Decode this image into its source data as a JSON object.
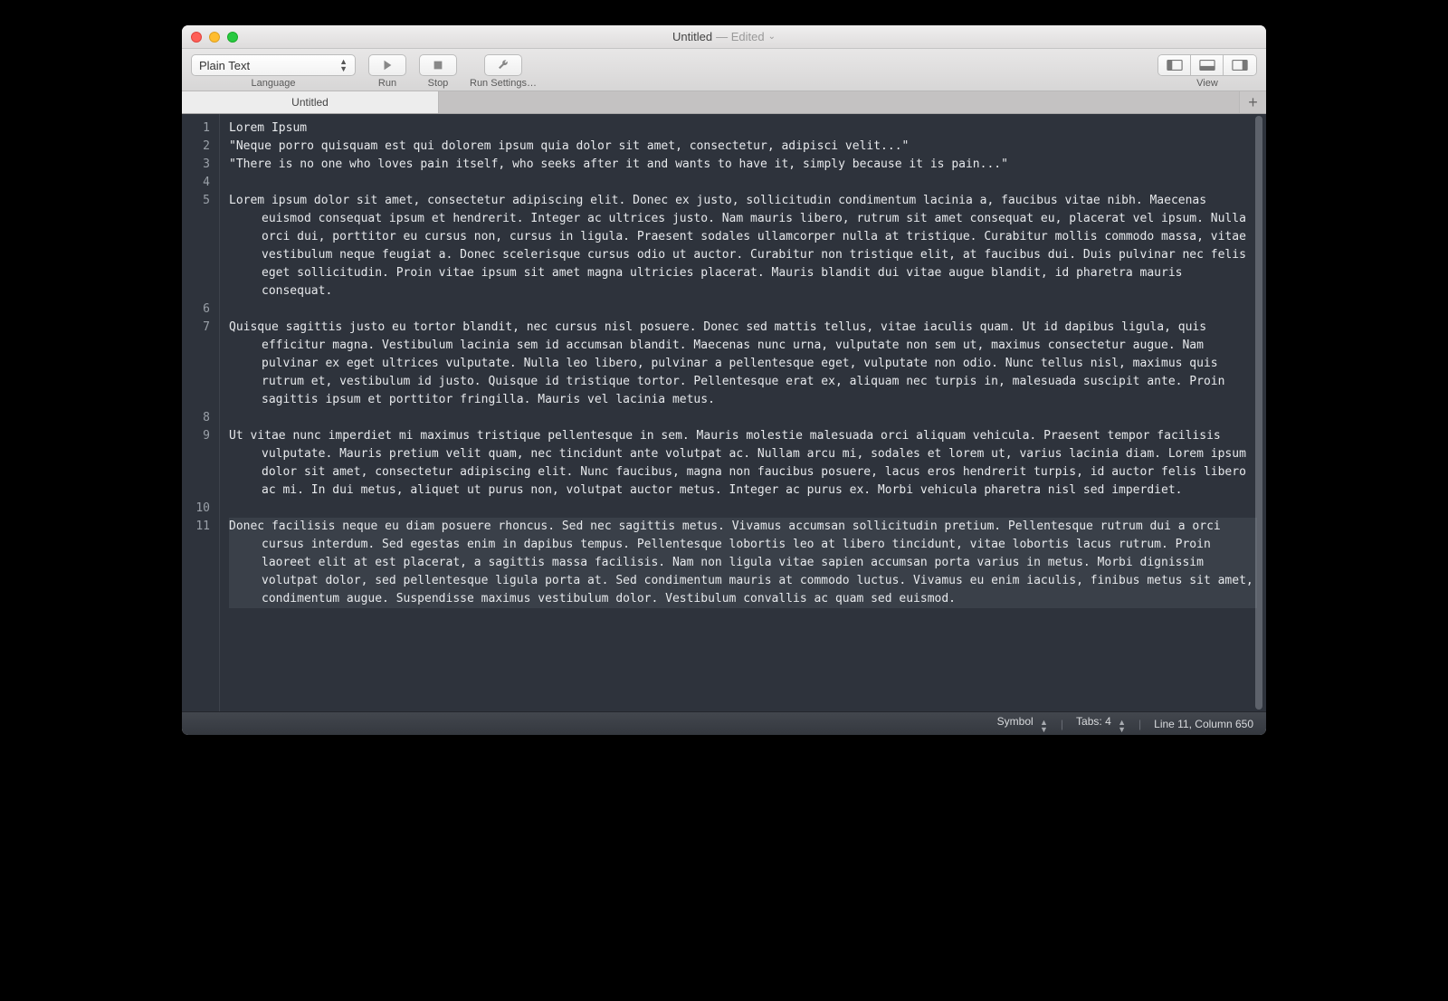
{
  "window": {
    "title": "Untitled",
    "edited_label": "— Edited"
  },
  "toolbar": {
    "language": {
      "value": "Plain Text",
      "label": "Language"
    },
    "run_label": "Run",
    "stop_label": "Stop",
    "settings_label": "Run Settings…",
    "view_label": "View"
  },
  "tabs": {
    "active": "Untitled"
  },
  "document": {
    "lines": [
      {
        "n": 1,
        "text": "Lorem Ipsum"
      },
      {
        "n": 2,
        "text": "\"Neque porro quisquam est qui dolorem ipsum quia dolor sit amet, consectetur, adipisci velit...\""
      },
      {
        "n": 3,
        "text": "\"There is no one who loves pain itself, who seeks after it and wants to have it, simply because it is pain...\""
      },
      {
        "n": 4,
        "text": ""
      },
      {
        "n": 5,
        "text": "Lorem ipsum dolor sit amet, consectetur adipiscing elit. Donec ex justo, sollicitudin condimentum lacinia a, faucibus vitae nibh. Maecenas euismod consequat ipsum et hendrerit. Integer ac ultrices justo. Nam mauris libero, rutrum sit amet consequat eu, placerat vel ipsum. Nulla orci dui, porttitor eu cursus non, cursus in ligula. Praesent sodales ullamcorper nulla at tristique. Curabitur mollis commodo massa, vitae vestibulum neque feugiat a. Donec scelerisque cursus odio ut auctor. Curabitur non tristique elit, at faucibus dui. Duis pulvinar nec felis eget sollicitudin. Proin vitae ipsum sit amet magna ultricies placerat. Mauris blandit dui vitae augue blandit, id pharetra mauris consequat."
      },
      {
        "n": 6,
        "text": ""
      },
      {
        "n": 7,
        "text": "Quisque sagittis justo eu tortor blandit, nec cursus nisl posuere. Donec sed mattis tellus, vitae iaculis quam. Ut id dapibus ligula, quis efficitur magna. Vestibulum lacinia sem id accumsan blandit. Maecenas nunc urna, vulputate non sem ut, maximus consectetur augue. Nam pulvinar ex eget ultrices vulputate. Nulla leo libero, pulvinar a pellentesque eget, vulputate non odio. Nunc tellus nisl, maximus quis rutrum et, vestibulum id justo. Quisque id tristique tortor. Pellentesque erat ex, aliquam nec turpis in, malesuada suscipit ante. Proin sagittis ipsum et porttitor fringilla. Mauris vel lacinia metus."
      },
      {
        "n": 8,
        "text": ""
      },
      {
        "n": 9,
        "text": "Ut vitae nunc imperdiet mi maximus tristique pellentesque in sem. Mauris molestie malesuada orci aliquam vehicula. Praesent tempor facilisis vulputate. Mauris pretium velit quam, nec tincidunt ante volutpat ac. Nullam arcu mi, sodales et lorem ut, varius lacinia diam. Lorem ipsum dolor sit amet, consectetur adipiscing elit. Nunc faucibus, magna non faucibus posuere, lacus eros hendrerit turpis, id auctor felis libero ac mi. In dui metus, aliquet ut purus non, volutpat auctor metus. Integer ac purus ex. Morbi vehicula pharetra nisl sed imperdiet."
      },
      {
        "n": 10,
        "text": ""
      },
      {
        "n": 11,
        "text": "Donec facilisis neque eu diam posuere rhoncus. Sed nec sagittis metus. Vivamus accumsan sollicitudin pretium. Pellentesque rutrum dui a orci cursus interdum. Sed egestas enim in dapibus tempus. Pellentesque lobortis leo at libero tincidunt, vitae lobortis lacus rutrum. Proin laoreet elit at est placerat, a sagittis massa facilisis. Nam non ligula vitae sapien accumsan porta varius in metus. Morbi dignissim volutpat dolor, sed pellentesque ligula porta at. Sed condimentum mauris at commodo luctus. Vivamus eu enim iaculis, finibus metus sit amet, condimentum augue. Suspendisse maximus vestibulum dolor. Vestibulum convallis ac quam sed euismod."
      }
    ],
    "cursor_line": 11
  },
  "statusbar": {
    "symbol": "Symbol",
    "tabs": "Tabs: 4",
    "position": "Line 11, Column 650"
  }
}
